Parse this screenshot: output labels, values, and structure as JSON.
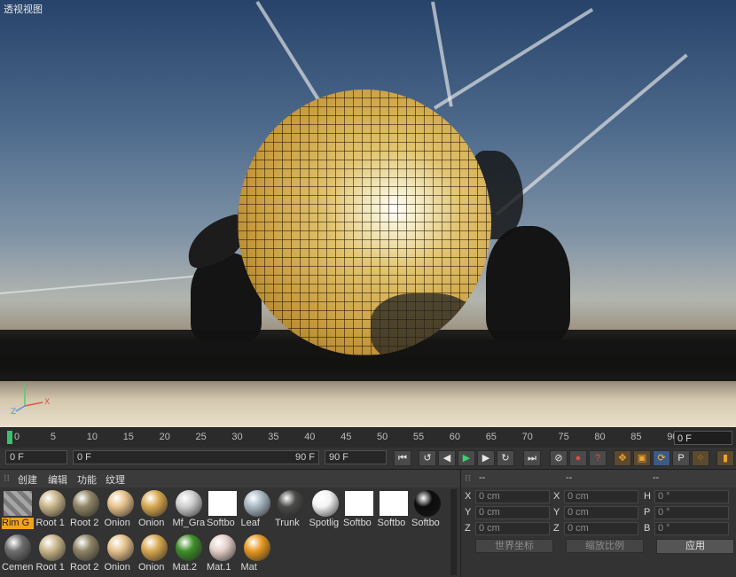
{
  "viewport": {
    "title": "透视视图"
  },
  "timeline": {
    "ticks": [
      "0",
      "5",
      "10",
      "15",
      "20",
      "25",
      "30",
      "35",
      "40",
      "45",
      "50",
      "55",
      "60",
      "65",
      "70",
      "75",
      "80",
      "85",
      "90"
    ],
    "current_frame": "0 F"
  },
  "transport": {
    "start_frame": "0 F",
    "range_start": "0 F",
    "range_end": "90 F",
    "end_frame": "90 F",
    "buttons": {
      "go_start": "⏮",
      "prev_key": "↺",
      "step_back": "◀",
      "play": "▶",
      "step_forward": "▶",
      "next_key": "↻",
      "go_end": "⏭",
      "record_keys": "⊘",
      "auto_key": "●",
      "help_key": "?",
      "move": "✥",
      "scale": "▣",
      "rotate": "⟳",
      "param": "P",
      "grid": "⁘",
      "film": "▮"
    }
  },
  "materials": {
    "menu": [
      "创建",
      "编辑",
      "功能",
      "纹理"
    ],
    "row1": [
      {
        "label": "Rim G",
        "color": "#8c8c8c",
        "selected": true,
        "type": "stripe"
      },
      {
        "label": "Root 1",
        "color": "#c9b58a",
        "type": "ball"
      },
      {
        "label": "Root 2",
        "color": "#8f8466",
        "type": "ball"
      },
      {
        "label": "Onion",
        "color": "#e6c28c",
        "type": "ball"
      },
      {
        "label": "Onion",
        "color": "#d8a850",
        "type": "ball"
      },
      {
        "label": "Mf_Gra",
        "color": "#cfcfcf",
        "type": "ball"
      },
      {
        "label": "Softbo",
        "color": "#ffffff",
        "type": "square"
      },
      {
        "label": "Leaf",
        "color": "#a9b8c2",
        "type": "ball"
      },
      {
        "label": "Trunk",
        "color": "#4a4a48",
        "type": "ball"
      },
      {
        "label": "Spotlig",
        "color": "#f4f4f4",
        "type": "ball"
      },
      {
        "label": "Softbo",
        "color": "#ffffff",
        "type": "square"
      },
      {
        "label": "Softbo",
        "color": "#ffffff",
        "type": "square"
      },
      {
        "label": "Softbo",
        "color": "#0c0c0c",
        "type": "ball"
      }
    ],
    "row2": [
      {
        "label": "Cemen",
        "color": "#6e6e6e",
        "type": "ball"
      },
      {
        "label": "Root 1",
        "color": "#c9b58a",
        "type": "ball"
      },
      {
        "label": "Root 2",
        "color": "#8f8466",
        "type": "ball"
      },
      {
        "label": "Onion",
        "color": "#e6c28c",
        "type": "ball"
      },
      {
        "label": "Onion",
        "color": "#d8a850",
        "type": "ball"
      },
      {
        "label": "Mat.2",
        "color": "#3f8f2a",
        "type": "ball"
      },
      {
        "label": "Mat.1",
        "color": "#e4cfc8",
        "type": "ball"
      },
      {
        "label": "Mat",
        "color": "#e89a22",
        "type": "ball"
      }
    ]
  },
  "coordinates": {
    "headers": [
      "--",
      "--",
      "--"
    ],
    "rows": [
      {
        "a": "X",
        "av": "0 cm",
        "b": "X",
        "bv": "0 cm",
        "c": "H",
        "cv": "0 °"
      },
      {
        "a": "Y",
        "av": "0 cm",
        "b": "Y",
        "bv": "0 cm",
        "c": "P",
        "cv": "0 °"
      },
      {
        "a": "Z",
        "av": "0 cm",
        "b": "Z",
        "bv": "0 cm",
        "c": "B",
        "cv": "0 °"
      }
    ],
    "world_dropdown": "世界坐标",
    "scale_dropdown": "缩放比例",
    "apply_label": "应用"
  }
}
